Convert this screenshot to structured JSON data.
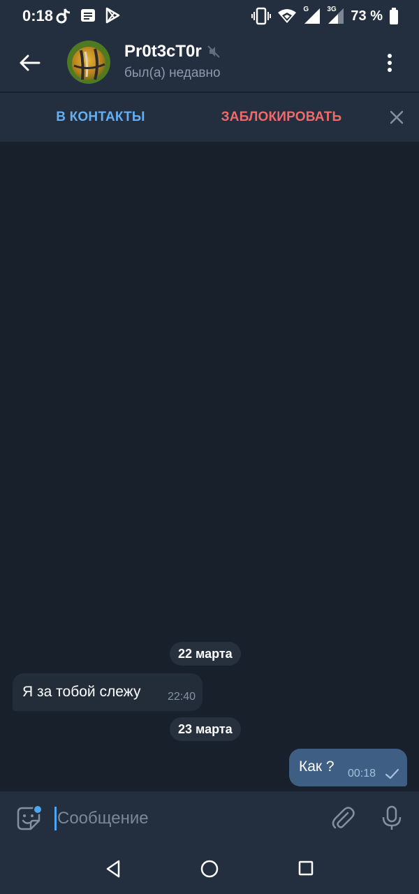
{
  "status_bar": {
    "time": "0:18",
    "network_g": "G",
    "network_3g": "3G",
    "battery_percent": "73 %",
    "icons": [
      "tiktok-icon",
      "notes-icon",
      "play-store-icon",
      "vibrate-icon",
      "wifi-icon",
      "signal-g-icon",
      "signal-3g-icon",
      "battery-icon"
    ]
  },
  "header": {
    "title": "Pr0t3cT0r",
    "subtitle": "был(а) недавно",
    "icons": [
      "back-arrow-icon",
      "avatar",
      "muted-icon",
      "more-vert-icon"
    ]
  },
  "action_bar": {
    "add_contact": "В КОНТАКТЫ",
    "block": "ЗАБЛОКИРОВАТЬ",
    "close_icon": "close-icon"
  },
  "chat": {
    "messages": [
      {
        "type": "date",
        "text": "22 марта"
      },
      {
        "type": "incoming",
        "text": "Я за тобой слежу",
        "time": "22:40"
      },
      {
        "type": "date",
        "text": "23 марта"
      },
      {
        "type": "outgoing",
        "text": "Как ?",
        "time": "00:18",
        "status": "sent-check-icon"
      }
    ]
  },
  "composer": {
    "placeholder": "Сообщение",
    "icons": [
      "sticker-emoji-icon",
      "attach-icon",
      "mic-icon"
    ]
  },
  "nav_bar": {
    "icons": [
      "nav-back-icon",
      "nav-home-icon",
      "nav-recents-icon"
    ]
  },
  "colors": {
    "background": "#18202b",
    "bar": "#232f3e",
    "accent_blue": "#66aef0",
    "accent_red": "#ee6b6b",
    "bubble_in": "#222d39",
    "bubble_out": "#3f5e83"
  }
}
